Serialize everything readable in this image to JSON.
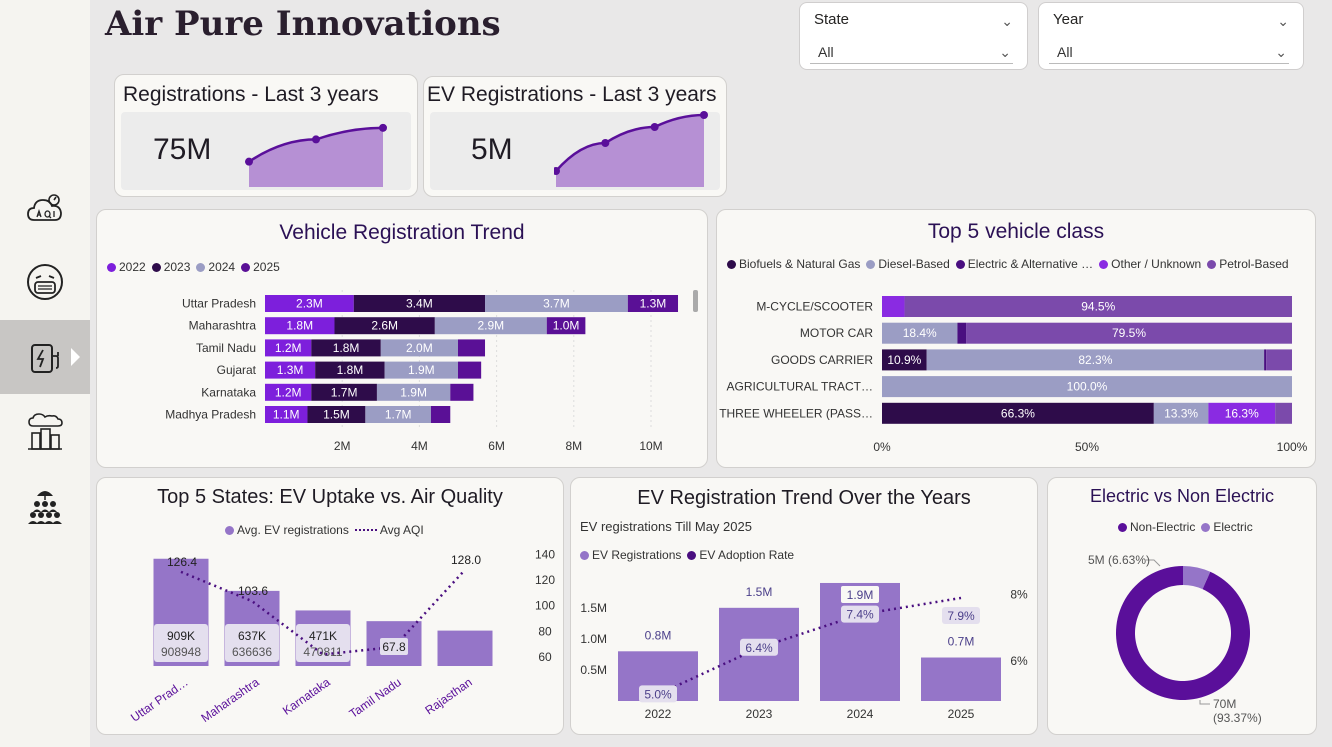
{
  "header": {
    "title": "Air Pure Innovations"
  },
  "filters": [
    {
      "label": "State",
      "value": "All"
    },
    {
      "label": "Year",
      "value": "All"
    }
  ],
  "nav": [
    {
      "name": "aqi-icon",
      "active": false
    },
    {
      "name": "mask-face-icon",
      "active": false
    },
    {
      "name": "ev-charger-icon",
      "active": true
    },
    {
      "name": "polluted-city-icon",
      "active": false
    },
    {
      "name": "people-group-icon",
      "active": false
    }
  ],
  "kpis": [
    {
      "title": "Registrations - Last 3 years",
      "value": "75M",
      "trend": [
        22,
        26.6,
        29
      ]
    },
    {
      "title": "EV Registrations - Last 3 years",
      "value": "5M",
      "trend": [
        0.8,
        1.5,
        1.9,
        2.2
      ]
    }
  ],
  "colors": {
    "y2022": "#7d1fdc",
    "y2023": "#2e0c4a",
    "y2024": "#9b9dc4",
    "y2025": "#5a1096",
    "biofuels": "#2e0c4a",
    "diesel": "#9b9dc4",
    "electric": "#4a0f80",
    "other": "#8a2be2",
    "petrol": "#7b4aab",
    "ev_bar": "#9575c8",
    "ev_line": "#4a0f80",
    "non_electric": "#5a0f9a",
    "electric_slice": "#9575c8"
  },
  "chart_data": [
    {
      "id": "vehicle_registration_trend",
      "type": "bar",
      "orientation": "horizontal",
      "stacked": true,
      "title": "Vehicle Registration Trend",
      "categories": [
        "Uttar Pradesh",
        "Maharashtra",
        "Tamil Nadu",
        "Gujarat",
        "Karnataka",
        "Madhya Pradesh"
      ],
      "series": [
        {
          "name": "2022",
          "values": [
            2.3,
            1.8,
            1.2,
            1.3,
            1.2,
            1.1
          ],
          "labels": [
            "2.3M",
            "1.8M",
            "1.2M",
            "1.3M",
            "1.2M",
            "1.1M"
          ]
        },
        {
          "name": "2023",
          "values": [
            3.4,
            2.6,
            1.8,
            1.8,
            1.7,
            1.5
          ],
          "labels": [
            "3.4M",
            "2.6M",
            "1.8M",
            "1.8M",
            "1.7M",
            "1.5M"
          ]
        },
        {
          "name": "2024",
          "values": [
            3.7,
            2.9,
            2.0,
            1.9,
            1.9,
            1.7
          ],
          "labels": [
            "3.7M",
            "2.9M",
            "2.0M",
            "1.9M",
            "1.9M",
            "1.7M"
          ]
        },
        {
          "name": "2025",
          "values": [
            1.3,
            1.0,
            0.7,
            0.6,
            0.6,
            0.5
          ],
          "labels": [
            "1.3M",
            "1.0M",
            "",
            "",
            "",
            ""
          ]
        }
      ],
      "xticks": [
        "2M",
        "4M",
        "6M",
        "8M",
        "10M"
      ],
      "xtick_values": [
        2,
        4,
        6,
        8,
        10
      ],
      "xlim": [
        0,
        11
      ],
      "legend": "top-left"
    },
    {
      "id": "top5_vehicle_class",
      "type": "bar",
      "orientation": "horizontal",
      "stacked": true,
      "percent": true,
      "title": "Top 5 vehicle class",
      "categories": [
        "M-CYCLE/SCOOTER",
        "MOTOR CAR",
        "GOODS CARRIER",
        "AGRICULTURAL TRACT…",
        "THREE WHEELER (PASS…"
      ],
      "series": [
        {
          "name": "Biofuels & Natural Gas",
          "values": [
            0,
            0,
            10.9,
            0,
            66.3
          ],
          "labels": [
            "",
            "",
            "10.9%",
            "",
            "66.3%"
          ]
        },
        {
          "name": "Diesel-Based",
          "values": [
            0,
            18.4,
            82.3,
            100.0,
            13.3
          ],
          "labels": [
            "",
            "18.4%",
            "82.3%",
            "100.0%",
            "13.3%"
          ]
        },
        {
          "name": "Electric & Alternative …",
          "values": [
            0,
            2.1,
            0.5,
            0,
            0
          ],
          "labels": [
            "",
            "",
            "",
            "",
            ""
          ]
        },
        {
          "name": "Other / Unknown",
          "values": [
            5.5,
            0,
            0,
            0,
            16.3
          ],
          "labels": [
            "",
            "",
            "",
            "",
            "16.3%"
          ]
        },
        {
          "name": "Petrol-Based",
          "values": [
            94.5,
            79.5,
            6.3,
            0,
            4.1
          ],
          "labels": [
            "94.5%",
            "79.5%",
            "",
            "",
            ""
          ]
        }
      ],
      "xticks": [
        "0%",
        "50%",
        "100%"
      ],
      "xtick_values": [
        0,
        50,
        100
      ],
      "legend": "top"
    },
    {
      "id": "ev_uptake_vs_aqi",
      "type": "bar",
      "title": "Top 5 States: EV Uptake vs. Air Quality",
      "categories": [
        "Uttar Prad…",
        "Maharashtra",
        "Karnataka",
        "Tamil Nadu",
        "Rajasthan"
      ],
      "series": [
        {
          "name": "Avg. EV registrations",
          "type": "bar",
          "values": [
            908948,
            636636,
            470811,
            380000,
            300000
          ],
          "labels": [
            "909K",
            "637K",
            "471K",
            "",
            ""
          ],
          "sublabels": [
            "908948",
            "636636",
            "470811",
            "",
            ""
          ]
        },
        {
          "name": "Avg AQI",
          "type": "line",
          "values": [
            126.4,
            103.6,
            62,
            67.8,
            128.0
          ],
          "labels": [
            "126.4",
            "103.6",
            "",
            "67.8",
            "128.0"
          ]
        }
      ],
      "y2ticks": [
        "60",
        "80",
        "100",
        "120",
        "140"
      ],
      "y2tick_values": [
        60,
        80,
        100,
        120,
        140
      ],
      "y2lim": [
        53,
        145
      ],
      "ylim": [
        0,
        1000000
      ],
      "legend": "top"
    },
    {
      "id": "ev_registration_trend",
      "type": "bar",
      "title": "EV Registration Trend Over the Years",
      "subtitle": "EV registrations Till May 2025",
      "categories": [
        "2022",
        "2023",
        "2024",
        "2025"
      ],
      "series": [
        {
          "name": "EV Registrations",
          "type": "bar",
          "values": [
            0.8,
            1.5,
            1.9,
            0.7
          ],
          "labels": [
            "0.8M",
            "1.5M",
            "1.9M",
            "0.7M"
          ]
        },
        {
          "name": "EV Adoption Rate",
          "type": "line",
          "values": [
            5.0,
            6.4,
            7.4,
            7.9
          ],
          "labels": [
            "5.0%",
            "6.4%",
            "7.4%",
            "7.9%"
          ]
        }
      ],
      "yticks": [
        "0.5M",
        "1.0M",
        "1.5M"
      ],
      "ytick_values": [
        0.5,
        1.0,
        1.5
      ],
      "ylim": [
        0,
        1.98
      ],
      "y2ticks": [
        "6%",
        "8%"
      ],
      "y2tick_values": [
        6,
        8
      ],
      "y2lim": [
        4.8,
        8.5
      ],
      "legend": "top-left"
    },
    {
      "id": "electric_vs_non_electric",
      "type": "pie",
      "donut": true,
      "title": "Electric vs Non Electric",
      "slices": [
        {
          "name": "Non-Electric",
          "value": 70,
          "label": "70M",
          "pct": "(93.37%)"
        },
        {
          "name": "Electric",
          "value": 5,
          "label": "5M (6.63%)",
          "pct": ""
        }
      ],
      "legend": "top"
    }
  ]
}
